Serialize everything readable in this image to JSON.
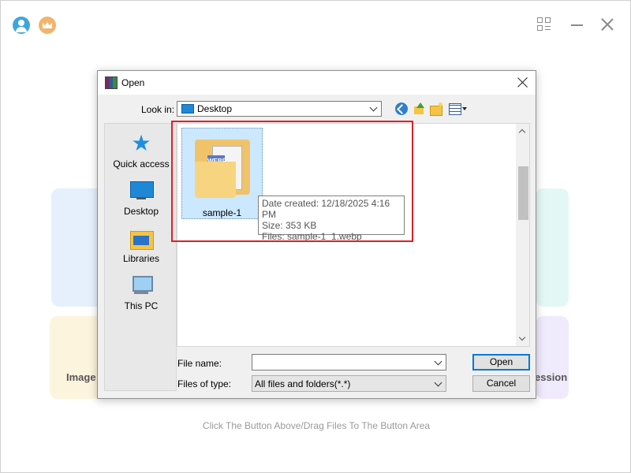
{
  "app": {
    "footer_text": "Click The Button Above/Drag Files To The Button Area",
    "card_left_label": "Image",
    "card_right_label": "ession"
  },
  "dialog": {
    "title": "Open",
    "look_in_label": "Look in:",
    "look_in_value": "Desktop",
    "places": [
      {
        "label": "Quick access",
        "icon": "star-icon"
      },
      {
        "label": "Desktop",
        "icon": "desktop-icon"
      },
      {
        "label": "Libraries",
        "icon": "libraries-icon"
      },
      {
        "label": "This PC",
        "icon": "computer-icon"
      }
    ],
    "files": [
      {
        "name": "sample-1",
        "badge": "WEBP"
      }
    ],
    "tooltip": {
      "date_created": "Date created: 12/18/2025 4:16 PM",
      "size": "Size: 353 KB",
      "files": "Files: sample-1_1.webp"
    },
    "file_name_label": "File name:",
    "file_name_value": "",
    "files_of_type_label": "Files of type:",
    "files_of_type_value": "All files and folders(*.*)",
    "open_button": "Open",
    "cancel_button": "Cancel"
  },
  "colors": {
    "highlight": "#e01f25",
    "selection": "#cce8ff",
    "accent": "#0078d7"
  }
}
